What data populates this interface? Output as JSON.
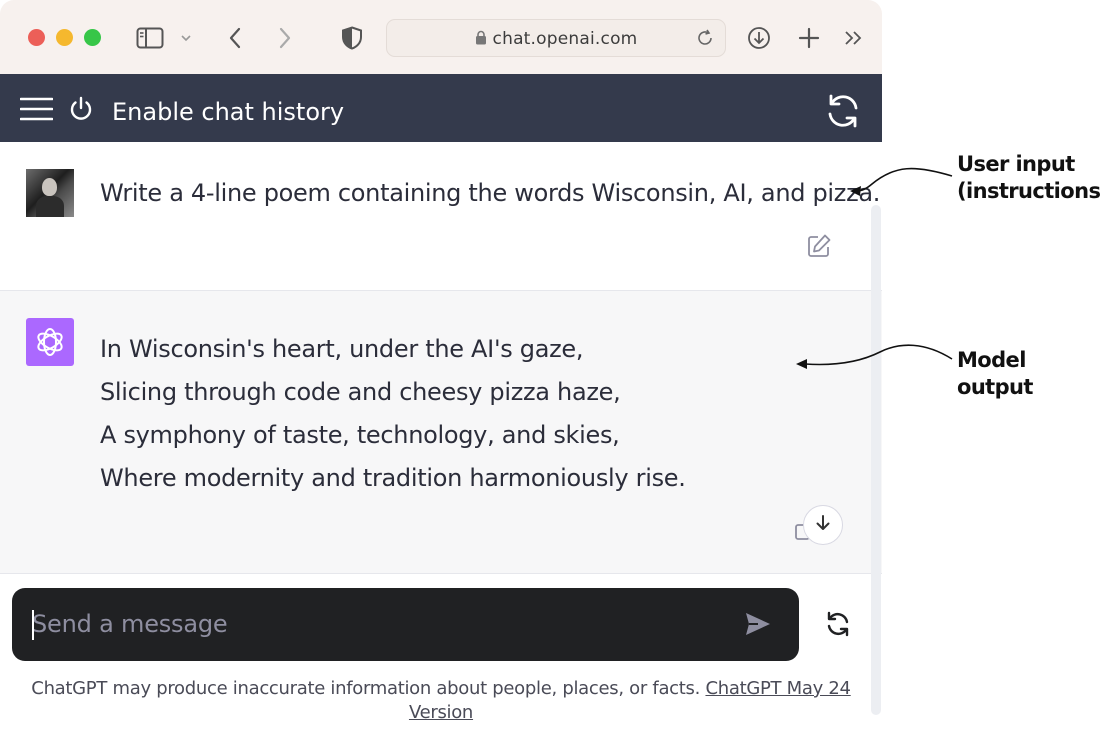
{
  "browser": {
    "url": "chat.openai.com"
  },
  "header": {
    "title": "Enable chat history"
  },
  "conversation": {
    "user_message": "Write a 4-line poem containing the words Wisconsin, AI, and pizza.",
    "assistant_lines": [
      "In Wisconsin's heart, under the AI's gaze,",
      "Slicing through code and cheesy pizza haze,",
      "A symphony of taste, technology, and skies,",
      "Where modernity and tradition harmoniously rise."
    ]
  },
  "composer": {
    "placeholder": "Send a message"
  },
  "footer": {
    "disclaimer": "ChatGPT may produce inaccurate information about people, places, or facts.",
    "version_link": "ChatGPT May 24 Version"
  },
  "annotations": {
    "user_input_line1": "User input",
    "user_input_line2": "(instructions)",
    "model_output": "Model output"
  },
  "icons": {
    "sidebar": "sidebar-toggle-icon",
    "back": "chevron-left-icon",
    "forward": "chevron-right-icon",
    "shield": "shield-icon",
    "reload": "reload-icon",
    "download": "download-icon",
    "new_tab": "plus-icon",
    "more": "double-chevron-icon",
    "menu": "hamburger-icon",
    "power": "power-icon",
    "refresh": "refresh-icon",
    "edit": "edit-icon",
    "copy": "copy-icon",
    "scroll_down": "arrow-down-icon",
    "send": "send-icon",
    "regenerate": "regenerate-icon"
  },
  "colors": {
    "header_bg": "#343a4c",
    "bot_avatar": "#ab68ff",
    "composer_bg": "#202123"
  }
}
